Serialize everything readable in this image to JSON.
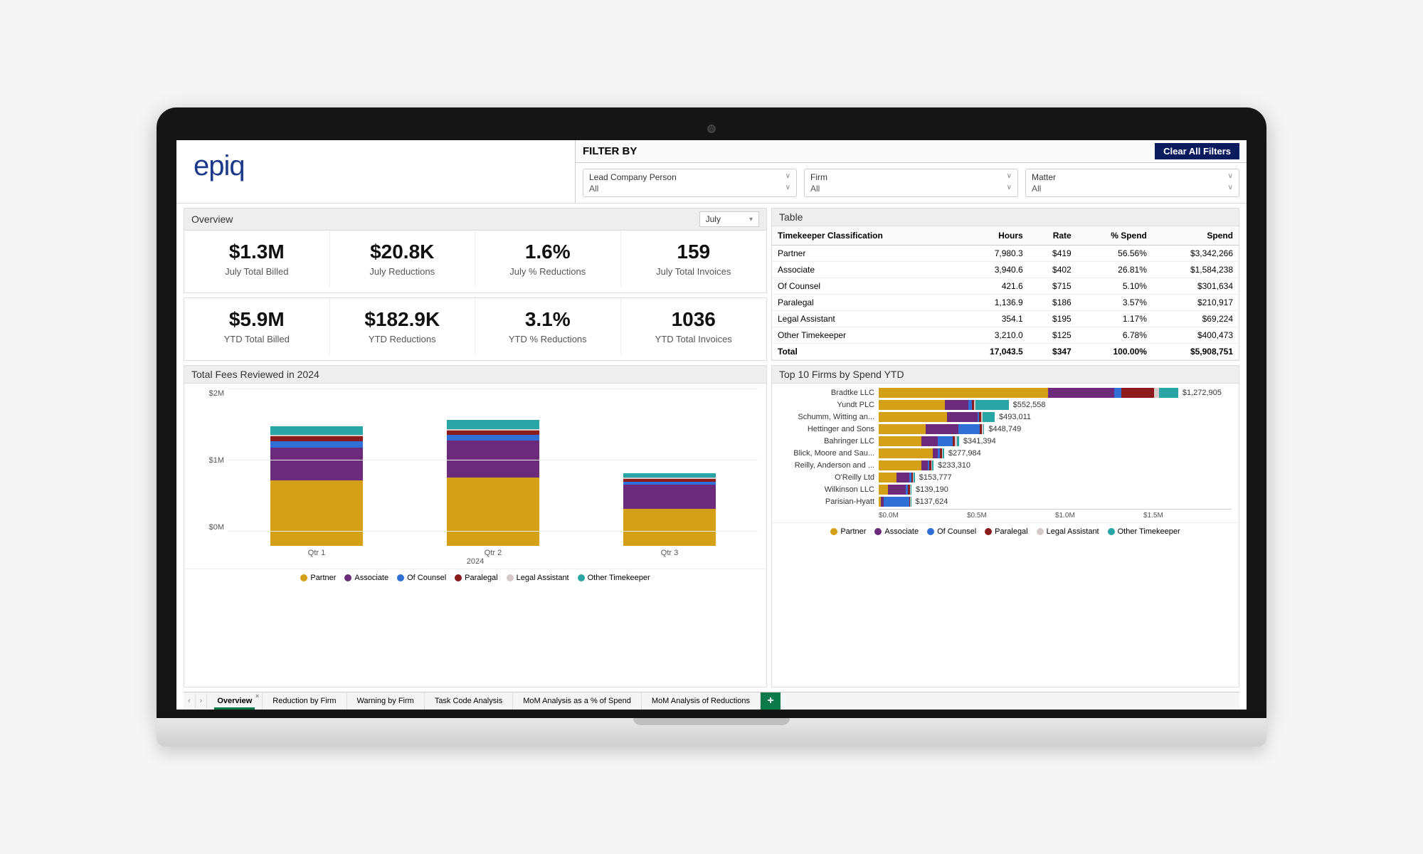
{
  "logo": "epiq",
  "filter": {
    "title": "FILTER BY",
    "clear": "Clear All Filters",
    "boxes": [
      {
        "label": "Lead Company Person",
        "value": "All"
      },
      {
        "label": "Firm",
        "value": "All"
      },
      {
        "label": "Matter",
        "value": "All"
      }
    ]
  },
  "overview": {
    "title": "Overview",
    "month": "July",
    "kpi_month": [
      {
        "val": "$1.3M",
        "lbl": "July Total Billed"
      },
      {
        "val": "$20.8K",
        "lbl": "July Reductions"
      },
      {
        "val": "1.6%",
        "lbl": "July % Reductions"
      },
      {
        "val": "159",
        "lbl": "July Total Invoices"
      }
    ],
    "kpi_ytd": [
      {
        "val": "$5.9M",
        "lbl": "YTD Total Billed"
      },
      {
        "val": "$182.9K",
        "lbl": "YTD Reductions"
      },
      {
        "val": "3.1%",
        "lbl": "YTD % Reductions"
      },
      {
        "val": "1036",
        "lbl": "YTD Total Invoices"
      }
    ]
  },
  "table": {
    "title": "Table",
    "headers": [
      "Timekeeper Classification",
      "Hours",
      "Rate",
      "% Spend",
      "Spend"
    ],
    "rows": [
      [
        "Partner",
        "7,980.3",
        "$419",
        "56.56%",
        "$3,342,266"
      ],
      [
        "Associate",
        "3,940.6",
        "$402",
        "26.81%",
        "$1,584,238"
      ],
      [
        "Of Counsel",
        "421.6",
        "$715",
        "5.10%",
        "$301,634"
      ],
      [
        "Paralegal",
        "1,136.9",
        "$186",
        "3.57%",
        "$210,917"
      ],
      [
        "Legal Assistant",
        "354.1",
        "$195",
        "1.17%",
        "$69,224"
      ],
      [
        "Other Timekeeper",
        "3,210.0",
        "$125",
        "6.78%",
        "$400,473"
      ]
    ],
    "total": [
      "Total",
      "17,043.5",
      "$347",
      "100.00%",
      "$5,908,751"
    ]
  },
  "fees_chart": {
    "title": "Total Fees Reviewed in 2024",
    "year": "2024"
  },
  "firms_chart": {
    "title": "Top 10 Firms by Spend YTD"
  },
  "legend": [
    "Partner",
    "Associate",
    "Of Counsel",
    "Paralegal",
    "Legal Assistant",
    "Other Timekeeper"
  ],
  "tabs": [
    "Overview",
    "Reduction by Firm",
    "Warning by Firm",
    "Task Code Analysis",
    "MoM Analysis as a % of Spend",
    "MoM Analysis of Reductions"
  ],
  "chart_data": [
    {
      "type": "bar",
      "title": "Total Fees Reviewed in 2024",
      "xlabel": "2024",
      "ylabel": "",
      "ylim": [
        0,
        2500000
      ],
      "yticks": [
        "$0M",
        "$1M",
        "$2M"
      ],
      "categories": [
        "Qtr 1",
        "Qtr 2",
        "Qtr 3"
      ],
      "series": [
        {
          "name": "Partner",
          "color": "#d4a017",
          "values": [
            1150000,
            1200000,
            650000
          ]
        },
        {
          "name": "Associate",
          "color": "#6b2a7a",
          "values": [
            580000,
            650000,
            420000
          ]
        },
        {
          "name": "Of Counsel",
          "color": "#2f6fd6",
          "values": [
            110000,
            100000,
            60000
          ]
        },
        {
          "name": "Paralegal",
          "color": "#8b1a1a",
          "values": [
            80000,
            70000,
            50000
          ]
        },
        {
          "name": "Legal Assistant",
          "color": "#d7c9c9",
          "values": [
            25000,
            25000,
            15000
          ]
        },
        {
          "name": "Other Timekeeper",
          "color": "#2aa5a5",
          "values": [
            155000,
            165000,
            75000
          ]
        }
      ]
    },
    {
      "type": "bar",
      "orientation": "horizontal",
      "title": "Top 10 Firms by Spend YTD",
      "xlim": [
        0,
        1500000
      ],
      "xticks": [
        "$0.0M",
        "$0.5M",
        "$1.0M",
        "$1.5M"
      ],
      "categories": [
        "Bradtke LLC",
        "Yundt PLC",
        "Schumm, Witting an...",
        "Hettinger and Sons",
        "Bahringer LLC",
        "Blick, Moore and Sau...",
        "Reilly, Anderson and ...",
        "O'Reilly Ltd",
        "Wilkinson LLC",
        "Parisian-Hyatt"
      ],
      "totals": [
        1272905,
        552558,
        493011,
        448749,
        341394,
        277984,
        233310,
        153777,
        139190,
        137624
      ],
      "value_labels": [
        "$1,272,905",
        "$552,558",
        "$493,011",
        "$448,749",
        "$341,394",
        "$277,984",
        "$233,310",
        "$153,777",
        "$139,190",
        "$137,624"
      ],
      "series": [
        {
          "name": "Partner",
          "color": "#d4a017",
          "values": [
            720000,
            280000,
            290000,
            200000,
            180000,
            230000,
            180000,
            75000,
            40000,
            10000
          ]
        },
        {
          "name": "Associate",
          "color": "#6b2a7a",
          "values": [
            280000,
            100000,
            130000,
            140000,
            70000,
            20000,
            30000,
            55000,
            75000,
            10000
          ]
        },
        {
          "name": "Of Counsel",
          "color": "#2f6fd6",
          "values": [
            30000,
            15000,
            5000,
            90000,
            65000,
            10000,
            5000,
            10000,
            10000,
            110000
          ]
        },
        {
          "name": "Paralegal",
          "color": "#8b1a1a",
          "values": [
            140000,
            10000,
            10000,
            8000,
            10000,
            8000,
            8000,
            6000,
            7000,
            4000
          ]
        },
        {
          "name": "Legal Assistant",
          "color": "#d7c9c9",
          "values": [
            22905,
            7558,
            8011,
            5749,
            6394,
            4984,
            5310,
            3777,
            3190,
            1624
          ]
        },
        {
          "name": "Other Timekeeper",
          "color": "#2aa5a5",
          "values": [
            80000,
            140000,
            50000,
            5000,
            10000,
            5000,
            5000,
            4000,
            4000,
            2000
          ]
        }
      ]
    }
  ]
}
